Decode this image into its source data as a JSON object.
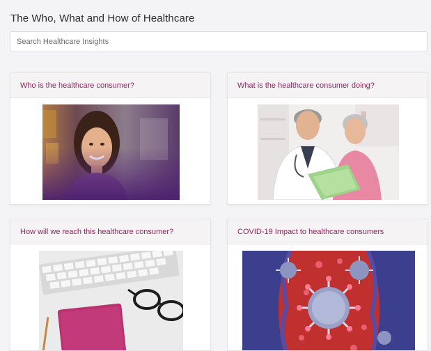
{
  "page": {
    "title": "The Who, What and How of Healthcare"
  },
  "search": {
    "placeholder": "Search Healthcare Insights",
    "value": ""
  },
  "cards": [
    {
      "title": "Who is the healthcare consumer?",
      "image": "smiling-woman-photo"
    },
    {
      "title": "What is the healthcare consumer doing?",
      "image": "doctor-patient-photo"
    },
    {
      "title": "How will we reach this healthcare consumer?",
      "image": "keyboard-notebook-glasses-photo"
    },
    {
      "title": "COVID-19 Impact to healthcare consumers",
      "image": "coronavirus-photo"
    }
  ],
  "colors": {
    "accent": "#8a2a5e",
    "background": "#f4f4f6",
    "card_header": "#f5f3f4"
  }
}
